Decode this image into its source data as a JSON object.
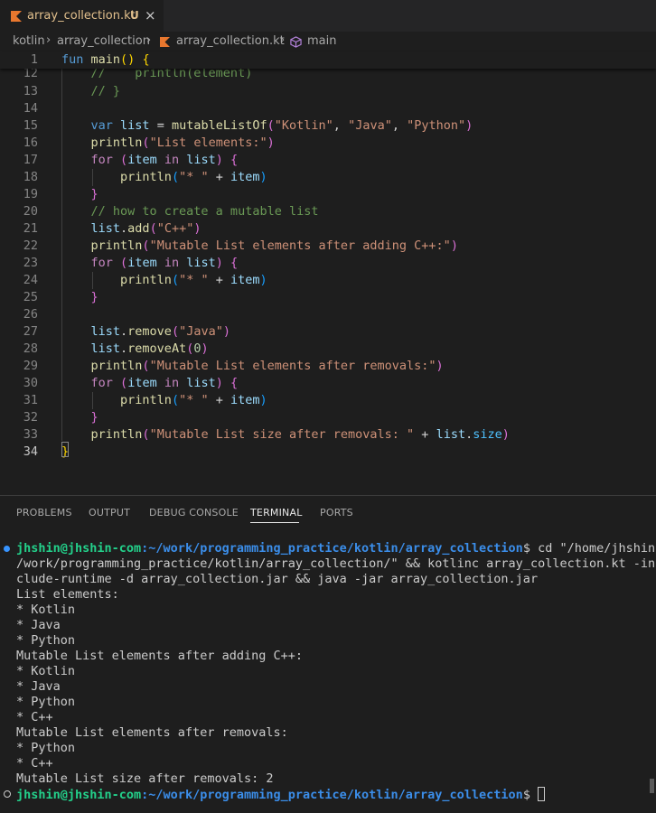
{
  "tab": {
    "file_name": "array_collection.kt",
    "status": "U",
    "close": "×"
  },
  "breadcrumb": {
    "items": [
      "kotlin",
      "array_collection",
      "array_collection.kt"
    ],
    "symbol": "main"
  },
  "editor": {
    "sticky": {
      "line": "1",
      "code": "fun main() {"
    },
    "lines": [
      {
        "n": "12",
        "code": "    //    println(element)"
      },
      {
        "n": "13",
        "code": "    // }"
      },
      {
        "n": "14",
        "code": ""
      },
      {
        "n": "15",
        "code": "    var list = mutableListOf(\"Kotlin\", \"Java\", \"Python\")"
      },
      {
        "n": "16",
        "code": "    println(\"List elements:\")"
      },
      {
        "n": "17",
        "code": "    for (item in list) {"
      },
      {
        "n": "18",
        "code": "        println(\"* \" + item)"
      },
      {
        "n": "19",
        "code": "    }"
      },
      {
        "n": "20",
        "code": "    // how to create a mutable list"
      },
      {
        "n": "21",
        "code": "    list.add(\"C++\")"
      },
      {
        "n": "22",
        "code": "    println(\"Mutable List elements after adding C++:\")"
      },
      {
        "n": "23",
        "code": "    for (item in list) {"
      },
      {
        "n": "24",
        "code": "        println(\"* \" + item)"
      },
      {
        "n": "25",
        "code": "    }"
      },
      {
        "n": "26",
        "code": ""
      },
      {
        "n": "27",
        "code": "    list.remove(\"Java\")"
      },
      {
        "n": "28",
        "code": "    list.removeAt(0)"
      },
      {
        "n": "29",
        "code": "    println(\"Mutable List elements after removals:\")"
      },
      {
        "n": "30",
        "code": "    for (item in list) {"
      },
      {
        "n": "31",
        "code": "        println(\"* \" + item)"
      },
      {
        "n": "32",
        "code": "    }"
      },
      {
        "n": "33",
        "code": "    println(\"Mutable List size after removals: \" + list.size)"
      },
      {
        "n": "34",
        "code": "}"
      }
    ]
  },
  "panel": {
    "tabs": [
      "PROBLEMS",
      "OUTPUT",
      "DEBUG CONSOLE",
      "TERMINAL",
      "PORTS"
    ],
    "active_tab": "TERMINAL"
  },
  "terminal": {
    "prompt_user": "jhshin@jhshin-com",
    "prompt_path": ":~/work/programming_practice/kotlin/array_collection",
    "command_lines": [
      "$ cd \"/home/jhshin",
      "/work/programming_practice/kotlin/array_collection/\" && kotlinc array_collection.kt -in",
      "clude-runtime -d array_collection.jar && java -jar array_collection.jar"
    ],
    "output": [
      "List elements:",
      "* Kotlin",
      "* Java",
      "* Python",
      "Mutable List elements after adding C++:",
      "* Kotlin",
      "* Java",
      "* Python",
      "* C++",
      "Mutable List elements after removals:",
      "* Python",
      "* C++",
      "Mutable List size after removals: 2"
    ],
    "final_prompt_suffix": "$ "
  },
  "colors": {
    "success_dot": "#3794ff",
    "idle_dot": "#cccccc",
    "user_green": "#23d18b",
    "path_blue": "#3b8eea"
  }
}
